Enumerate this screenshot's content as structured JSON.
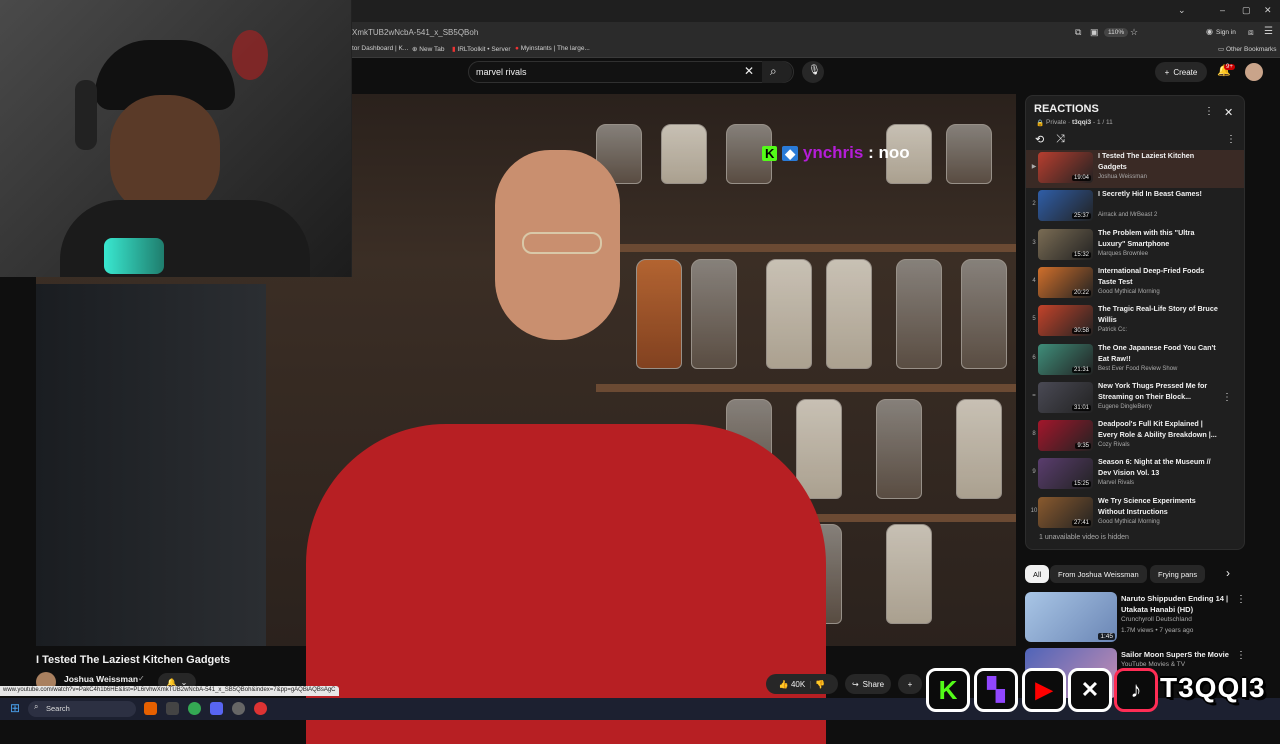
{
  "browser": {
    "url": "XmkTUB2wNcbA-541_x_SB5QBoh",
    "zoom": "110%",
    "sign_in": "Sign in",
    "bookmarks": [
      "tor Dashboard | K...",
      "New Tab",
      "IRLToolkit • Server",
      "Myinstants | The large..."
    ],
    "other_bookmarks": "Other Bookmarks"
  },
  "header": {
    "search_value": "marvel rivals",
    "create_label": "Create",
    "notif_count": "9+"
  },
  "overlay": {
    "chat_user": "ynchris",
    "chat_message": ": noo",
    "handle": "T3QQI3"
  },
  "video": {
    "title": "I Tested The Laziest Kitchen Gadgets",
    "channel": "Joshua Weissman",
    "likes": "40K",
    "share_label": "Share"
  },
  "status_url": "www.youtube.com/watch?v=PakC4h1b6HE&list=PL6rvhwXmkTUB2wNcbA-541_x_SB5QBoh&index=7&pp=gAQBiAQBsAgC",
  "playlist": {
    "title": "REACTIONS",
    "privacy": "Private",
    "owner": "t3qqi3",
    "position": "1 / 11",
    "hidden_note": "1 unavailable video is hidden",
    "items": [
      {
        "num": "▶",
        "title": "I Tested The Laziest Kitchen Gadgets",
        "channel": "Joshua Weissman",
        "duration": "19:04",
        "color": "#b83e2f"
      },
      {
        "num": "2",
        "title": "I Secretly Hid In Beast Games!",
        "channel": "Airrack and MrBeast 2",
        "duration": "25:37",
        "color": "#2f5ea8"
      },
      {
        "num": "3",
        "title": "The Problem with this \"Ultra Luxury\" Smartphone",
        "channel": "Marques Brownlee",
        "duration": "15:32",
        "color": "#7a6c54"
      },
      {
        "num": "4",
        "title": "International Deep-Fried Foods Taste Test",
        "channel": "Good Mythical Morning",
        "duration": "20:22",
        "color": "#d06f2b"
      },
      {
        "num": "5",
        "title": "The Tragic Real-Life Story of Bruce Willis",
        "channel": "Patrick Cc:",
        "duration": "30:58",
        "color": "#c4432a"
      },
      {
        "num": "6",
        "title": "The One Japanese Food You Can't Eat Raw!!",
        "channel": "Best Ever Food Review Show",
        "duration": "21:31",
        "color": "#3f8e7a"
      },
      {
        "num": "=",
        "title": "New York Thugs Pressed Me for Streaming on Their Block...",
        "channel": "Eugene DingleBerry",
        "duration": "31:01",
        "color": "#4a4a55"
      },
      {
        "num": "8",
        "title": "Deadpool's Full Kit Explained | Every Role & Ability Breakdown |...",
        "channel": "Cozy Rivals",
        "duration": "9:35",
        "color": "#a3162b"
      },
      {
        "num": "9",
        "title": "Season 6: Night at the Museum // Dev Vision Vol. 13",
        "channel": "Marvel Rivals",
        "duration": "15:25",
        "color": "#5a3d6e"
      },
      {
        "num": "10",
        "title": "We Try Science Experiments Without Instructions",
        "channel": "Good Mythical Morning",
        "duration": "27:41",
        "color": "#8a5a2e"
      }
    ]
  },
  "chips": [
    "All",
    "From Joshua Weissman",
    "Frying pans"
  ],
  "recommendations": [
    {
      "title": "Naruto Shippuden Ending 14 | Utakata Hanabi (HD)",
      "channel": "Crunchyroll Deutschland",
      "meta": "1.7M views • 7 years ago",
      "duration": "1:45",
      "color": "#6f90b8"
    },
    {
      "title": "Sailor Moon SuperS the Movie",
      "channel": "YouTube Movies & TV",
      "meta": "",
      "duration": "",
      "color": "#3b4d9a"
    }
  ],
  "taskbar": {
    "search_label": "Search"
  },
  "colors": {
    "accent": "#ff0000",
    "kick": "#53fc18",
    "twitch": "#9146ff",
    "youtube": "#ff0000"
  }
}
